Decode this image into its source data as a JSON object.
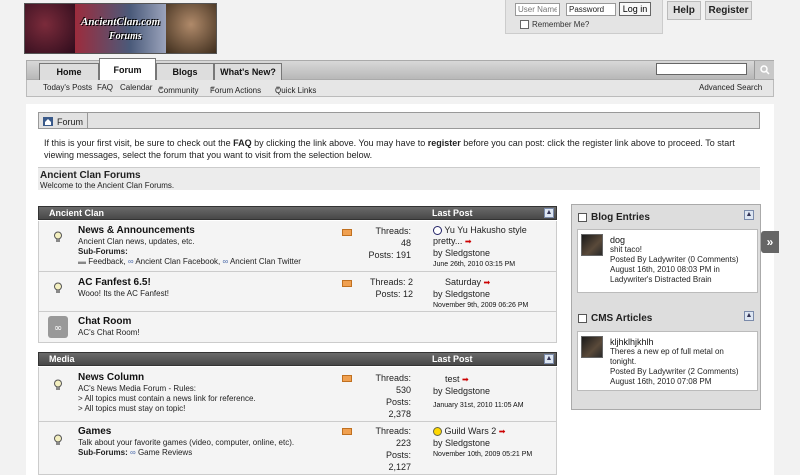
{
  "logo": {
    "line1": "AncientClan.com",
    "line2": "Forums"
  },
  "login": {
    "username_placeholder": "User Name",
    "password_value": "Password",
    "login_label": "Log in",
    "remember_label": "Remember Me?"
  },
  "top_buttons": {
    "help": "Help",
    "register": "Register"
  },
  "nav": {
    "tabs": [
      "Home",
      "Forum",
      "Blogs",
      "What's New?"
    ],
    "active_tab": "Forum"
  },
  "subnav": {
    "items": [
      "Today's Posts",
      "FAQ",
      "Calendar",
      "Community",
      "Forum Actions",
      "Quick Links"
    ],
    "advanced_search": "Advanced Search"
  },
  "breadcrumb": {
    "label": "Forum"
  },
  "notice": {
    "part1": "If this is your first visit, be sure to check out the ",
    "faq": "FAQ",
    "part2": " by clicking the link above. You may have to ",
    "register": "register",
    "part3": " before you can post: click the register link above to proceed. To start viewing messages, select the forum that you want to visit from the selection below."
  },
  "page": {
    "title": "Ancient Clan Forums",
    "subtitle": "Welcome to the Ancient Clan Forums."
  },
  "categories": [
    {
      "name": "Ancient Clan",
      "last_post_header": "Last Post"
    },
    {
      "name": "Media",
      "last_post_header": "Last Post"
    }
  ],
  "forums": {
    "news": {
      "name": "News & Announcements",
      "desc": "Ancient Clan news, updates, etc.",
      "sub_label": "Sub-Forums:",
      "subs": [
        "Feedback",
        "Ancient Clan Facebook",
        "Ancient Clan Twitter"
      ],
      "threads_label": "Threads:",
      "threads": "48",
      "posts_label": "Posts:",
      "posts": "191",
      "last_title": "Yu Yu Hakusho style pretty...",
      "by": "by",
      "last_by": "Sledgstone",
      "last_date": "June 26th, 2010",
      "last_time": "03:15 PM"
    },
    "fanfest": {
      "name": "AC Fanfest 6.5!",
      "desc": "Wooo! Its the AC Fanfest!",
      "threads_label": "Threads:",
      "threads": "2",
      "posts_label": "Posts:",
      "posts": "12",
      "last_title": "Saturday",
      "by": "by",
      "last_by": "Sledgstone",
      "last_date": "November 9th, 2009",
      "last_time": "06:26 PM"
    },
    "chat": {
      "name": "Chat Room",
      "desc": "AC's Chat Room!"
    },
    "news_column": {
      "name": "News Column",
      "desc1": "AC's News Media Forum - Rules:",
      "desc2": "> All topics must contain a news link for reference.",
      "desc3": "> All topics must stay on topic!",
      "threads_label": "Threads:",
      "threads": "530",
      "posts_label": "Posts:",
      "posts": "2,378",
      "last_title": "test",
      "by": "by",
      "last_by": "Sledgstone",
      "last_date": "January 31st, 2010",
      "last_time": "11:05 AM"
    },
    "games": {
      "name": "Games",
      "desc": "Talk about your favorite games (video, computer, online, etc).",
      "sub_label": "Sub-Forums:",
      "subs": [
        "Game Reviews"
      ],
      "threads_label": "Threads:",
      "threads": "223",
      "posts_label": "Posts:",
      "posts": "2,127",
      "last_title": "Guild Wars 2",
      "by": "by",
      "last_by": "Sledgstone",
      "last_date": "November 10th, 2009",
      "last_time": "05:21 PM"
    }
  },
  "sidebar": {
    "blog": {
      "header": "Blog Entries",
      "title": "dog",
      "excerpt": "shit taco!",
      "posted_by": "Posted By",
      "author": "Ladywriter",
      "comments": "(0 Comments)",
      "date": "August 16th, 2010 08:03 PM in",
      "blog_name": "Ladywriter's Distracted Brain"
    },
    "cms": {
      "header": "CMS Articles",
      "title": "kljhklhjkhlh",
      "excerpt": "Theres a new ep of full metal on tonight.",
      "posted_by": "Posted By",
      "author": "Ladywriter",
      "comments": "(2 Comments)",
      "date": "August 16th, 2010 07:08 PM"
    }
  },
  "colors": {
    "category_bar": "#5a5a5a",
    "rss": "#f0a050",
    "hot_icon": "#cc0000",
    "sub_link_icon": "#4a6aaa"
  }
}
